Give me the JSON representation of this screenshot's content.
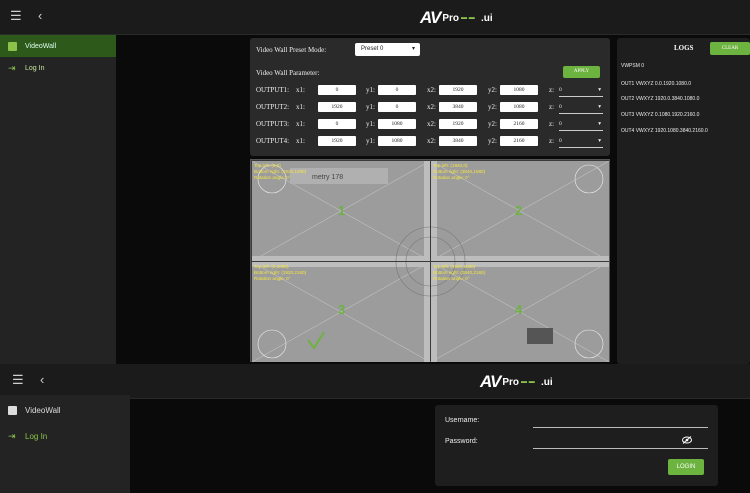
{
  "header": {
    "menu_icon": "menu-icon",
    "back_icon": "chevron-left-icon",
    "logo_av": "AV",
    "logo_pro": "Pro",
    "logo_ui": ".ui"
  },
  "sidebar": {
    "items": [
      {
        "label": "VideoWall",
        "icon": "grid-icon"
      },
      {
        "label": "Log In",
        "icon": "login-icon"
      }
    ]
  },
  "videowall": {
    "preset_mode_label": "Video Wall Preset Mode:",
    "preset_value": "Preset 0",
    "parameter_label": "Video Wall Parameter:",
    "apply_label": "APPLY",
    "outputs": [
      {
        "label": "OUTPUT1:",
        "x1": "0",
        "y1": "0",
        "x2": "1920",
        "y2": "1080",
        "z": "0"
      },
      {
        "label": "OUTPUT2:",
        "x1": "1920",
        "y1": "0",
        "x2": "3840",
        "y2": "1080",
        "z": "0"
      },
      {
        "label": "OUTPUT3:",
        "x1": "0",
        "y1": "1080",
        "x2": "1920",
        "y2": "2160",
        "z": "0"
      },
      {
        "label": "OUTPUT4:",
        "x1": "1920",
        "y1": "1080",
        "x2": "3840",
        "y2": "2160",
        "z": "0"
      }
    ],
    "field_labels": {
      "x1": "x1:",
      "y1": "y1:",
      "x2": "x2:",
      "y2": "y2:",
      "z": "z:"
    }
  },
  "preview": {
    "quads": [
      {
        "number": "1",
        "lines": [
          "Top left: (0,0)",
          "Bottom right: (1920,1080)",
          "Rotation angle: 0°"
        ]
      },
      {
        "number": "2",
        "lines": [
          "Top left: (1920,0)",
          "Bottom right: (3840,1080)",
          "Rotation angle: 0°"
        ]
      },
      {
        "number": "3",
        "lines": [
          "Top left: (0,1080)",
          "Bottom right: (1920,2160)",
          "Rotation angle: 0°"
        ]
      },
      {
        "number": "4",
        "lines": [
          "Top left: (1920,1080)",
          "Bottom right: (3840,2160)",
          "Rotation angle: 0°"
        ]
      }
    ]
  },
  "logs": {
    "title": "LOGS",
    "clear_label": "CLEAR",
    "lines": [
      "VWPSM 0",
      "OUT1 VWXYZ 0.0.1920.1080.0",
      "OUT2 VWXYZ 1920.0.3840.1080.0",
      "OUT3 VWXYZ 0.1080.1920.2160.0",
      "OUT4 VWXYZ 1920.1080.3840.2160.0"
    ]
  },
  "login": {
    "username_label": "Username:",
    "password_label": "Password:",
    "login_label": "LOGIN"
  },
  "colors": {
    "accent": "#6db33f",
    "panel": "#2a2a2a",
    "background": "#0a0a0a"
  }
}
